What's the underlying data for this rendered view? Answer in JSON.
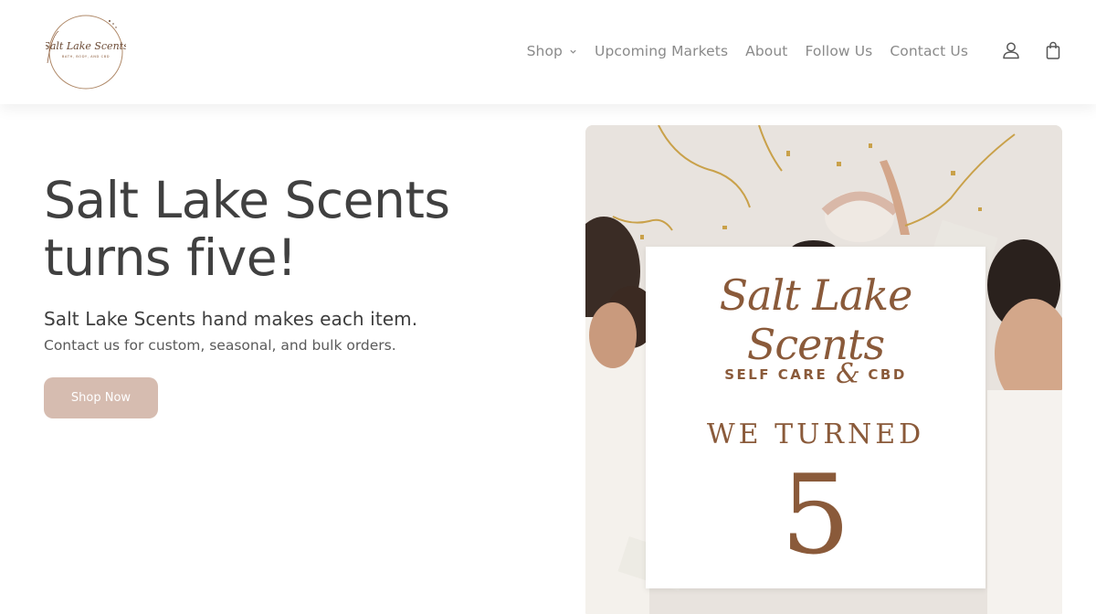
{
  "brand": {
    "logo_text": "Salt Lake Scents",
    "logo_tagline": "BATH, BODY, AND CBD"
  },
  "nav": {
    "items": [
      {
        "label": "Shop",
        "has_dropdown": true
      },
      {
        "label": "Upcoming Markets"
      },
      {
        "label": "About"
      },
      {
        "label": "Follow Us"
      },
      {
        "label": "Contact Us"
      }
    ],
    "icons": [
      "account-icon",
      "cart-icon"
    ]
  },
  "hero": {
    "title_line1": "Salt Lake Scents",
    "title_line2": "turns five!",
    "subtitle": "Salt Lake Scents hand makes each item.",
    "description": "Contact us for custom, seasonal, and bulk orders.",
    "cta_label": "Shop Now"
  },
  "promo_image": {
    "script_title": "Salt Lake Scents",
    "sub_left": "SELF CARE",
    "sub_amp": "&",
    "sub_right": "CBD",
    "announcement": "WE TURNED",
    "number": "5"
  },
  "colors": {
    "brand_brown": "#8a5a3a",
    "button_bg": "#d6bcb0",
    "nav_text": "#8a8a8a",
    "title_text": "#404040"
  }
}
